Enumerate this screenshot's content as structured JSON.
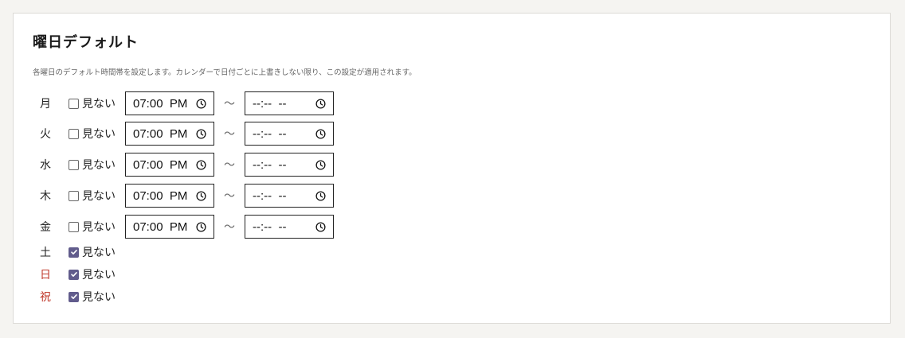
{
  "section": {
    "title": "曜日デフォルト",
    "description": "各曜日のデフォルト時間帯を設定します。カレンダーで日付ごとに上書きしない限り、この設定が適用されます。"
  },
  "hide_label": "見ない",
  "range_separator": "〜",
  "days": [
    {
      "label": "月",
      "hidden": false,
      "start": "07:00  PM",
      "end": "--:--  --",
      "color": "#222222"
    },
    {
      "label": "火",
      "hidden": false,
      "start": "07:00  PM",
      "end": "--:--  --",
      "color": "#222222"
    },
    {
      "label": "水",
      "hidden": false,
      "start": "07:00  PM",
      "end": "--:--  --",
      "color": "#222222"
    },
    {
      "label": "木",
      "hidden": false,
      "start": "07:00  PM",
      "end": "--:--  --",
      "color": "#222222"
    },
    {
      "label": "金",
      "hidden": false,
      "start": "07:00  PM",
      "end": "--:--  --",
      "color": "#222222"
    },
    {
      "label": "土",
      "hidden": true,
      "color": "#222222"
    },
    {
      "label": "日",
      "hidden": true,
      "color": "#c0392b"
    },
    {
      "label": "祝",
      "hidden": true,
      "color": "#c0392b"
    }
  ],
  "icons": {
    "time_picker": "clock-icon",
    "checkbox_checked": "checkmark-icon"
  },
  "colors": {
    "checkbox_checked": "#615c8c",
    "holiday_text": "#c0392b"
  }
}
